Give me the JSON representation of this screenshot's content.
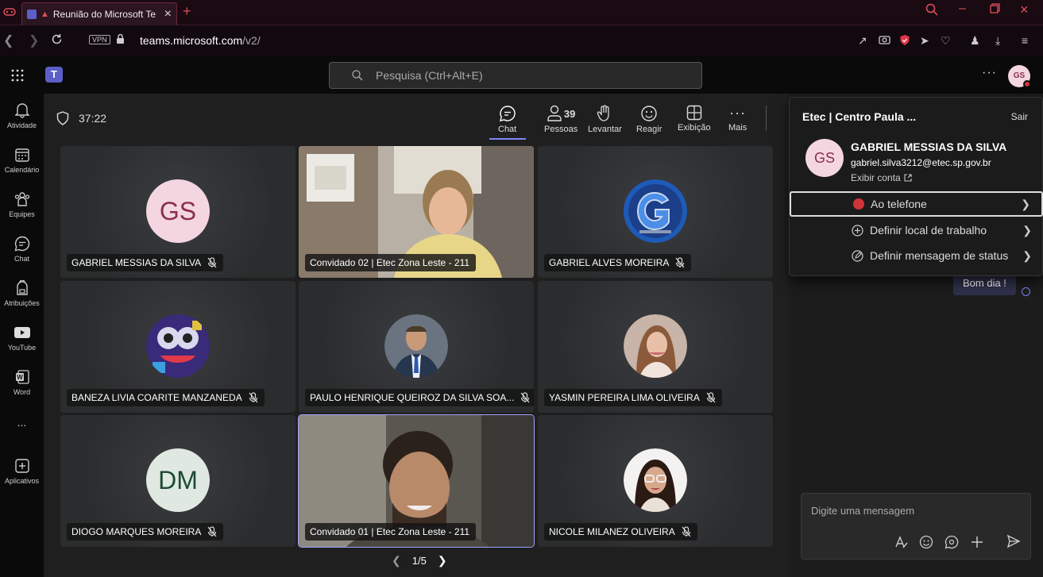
{
  "browser": {
    "tab_title": "Reunião do Microsoft Te",
    "vpn_label": "VPN",
    "url_host": "teams.microsoft.com",
    "url_path": "/v2/"
  },
  "teams_header": {
    "search_placeholder": "Pesquisa (Ctrl+Alt+E)",
    "avatar_initials": "GS"
  },
  "rail": [
    {
      "label": "Atividade",
      "icon": "bell-icon"
    },
    {
      "label": "Calendário",
      "icon": "calendar-icon"
    },
    {
      "label": "Equipes",
      "icon": "teams-icon"
    },
    {
      "label": "Chat",
      "icon": "chat-icon"
    },
    {
      "label": "Atribuições",
      "icon": "backpack-icon"
    },
    {
      "label": "YouTube",
      "icon": "youtube-icon"
    },
    {
      "label": "Word",
      "icon": "word-icon"
    },
    {
      "label": "...",
      "icon": "more-icon"
    },
    {
      "label": "Aplicativos",
      "icon": "add-apps-icon"
    }
  ],
  "meeting": {
    "timer": "37:22",
    "controls": {
      "chat": "Chat",
      "people": "Pessoas",
      "people_count": "39",
      "raise": "Levantar",
      "react": "Reagir",
      "view": "Exibição",
      "more": "Mais"
    },
    "tiles": [
      {
        "name": "GABRIEL MESSIAS DA SILVA",
        "kind": "initials",
        "initials": "GS"
      },
      {
        "name": "Convidado 02 | Etec Zona Leste - 211",
        "kind": "video"
      },
      {
        "name": "GABRIEL ALVES MOREIRA",
        "kind": "photo"
      },
      {
        "name": "BANEZA LIVIA COARITE MANZANEDA",
        "kind": "photo"
      },
      {
        "name": "PAULO HENRIQUE QUEIROZ DA SILVA SOA...",
        "kind": "photo"
      },
      {
        "name": "YASMIN PEREIRA LIMA OLIVEIRA",
        "kind": "photo"
      },
      {
        "name": "DIOGO MARQUES MOREIRA",
        "kind": "initials",
        "initials": "DM"
      },
      {
        "name": "Convidado 01 | Etec Zona Leste - 211",
        "kind": "video"
      },
      {
        "name": "NICOLE MILANEZ OLIVEIRA",
        "kind": "photo"
      }
    ],
    "pager": "1/5"
  },
  "chat": {
    "message": "Bom dia !",
    "composer_placeholder": "Digite uma mensagem"
  },
  "profile": {
    "org": "Etec | Centro Paula ...",
    "signout": "Sair",
    "initials": "GS",
    "name": "GABRIEL MESSIAS DA SILVA",
    "email": "gabriel.silva3212@etec.sp.gov.br",
    "view_account": "Exibir conta",
    "status": "Ao telefone",
    "work_location": "Definir local de trabalho",
    "status_message": "Definir mensagem de status"
  },
  "colors": {
    "accent": "#7f85f5",
    "busy": "#d13438",
    "avatar_bg": "#f4d6e0",
    "dm_bg": "#dfe9e2"
  }
}
